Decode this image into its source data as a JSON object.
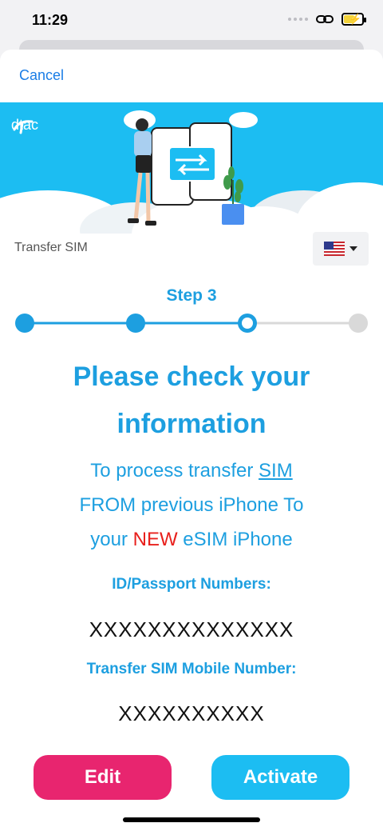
{
  "status_bar": {
    "time": "11:29"
  },
  "header": {
    "cancel_label": "Cancel"
  },
  "brand": {
    "name": "dtac"
  },
  "page": {
    "title": "Transfer SIM",
    "language_flag": "US"
  },
  "stepper": {
    "label": "Step 3",
    "current_step": 3,
    "total_steps": 4
  },
  "content": {
    "heading": "Please check your information",
    "line1_prefix": "To process transfer ",
    "line1_link": "SIM",
    "line2": "FROM previous iPhone To",
    "line3_prefix": "your ",
    "line3_highlight": "NEW",
    "line3_suffix": " eSIM iPhone",
    "id_label": "ID/Passport Numbers:",
    "id_value": "XXXXXXXXXXXXXX",
    "mobile_label": "Transfer SIM Mobile Number:",
    "mobile_value": "XXXXXXXXXX"
  },
  "actions": {
    "edit_label": "Edit",
    "activate_label": "Activate"
  },
  "colors": {
    "accent": "#1d9fe0",
    "banner": "#1cbdf2",
    "edit_button": "#e8256f",
    "highlight": "#e8201c"
  }
}
